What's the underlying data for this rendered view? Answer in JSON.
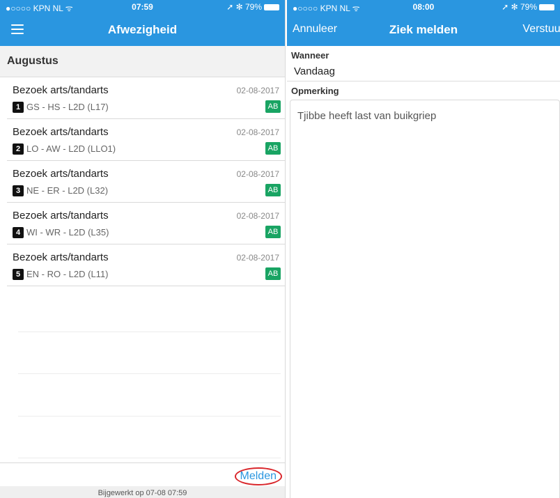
{
  "left": {
    "status": {
      "carrier": "●○○○○ KPN NL ᯤ",
      "time": "07:59",
      "battery": "➚ ✻ 79%"
    },
    "nav": {
      "title": "Afwezigheid"
    },
    "section": "Augustus",
    "items": [
      {
        "title": "Bezoek arts/tandarts",
        "date": "02-08-2017",
        "num": "1",
        "sub": "GS - HS - L2D (L17)",
        "badge": "AB"
      },
      {
        "title": "Bezoek arts/tandarts",
        "date": "02-08-2017",
        "num": "2",
        "sub": "LO - AW - L2D (LLO1)",
        "badge": "AB"
      },
      {
        "title": "Bezoek arts/tandarts",
        "date": "02-08-2017",
        "num": "3",
        "sub": "NE - ER - L2D (L32)",
        "badge": "AB"
      },
      {
        "title": "Bezoek arts/tandarts",
        "date": "02-08-2017",
        "num": "4",
        "sub": "WI - WR - L2D (L35)",
        "badge": "AB"
      },
      {
        "title": "Bezoek arts/tandarts",
        "date": "02-08-2017",
        "num": "5",
        "sub": "EN - RO - L2D (L11)",
        "badge": "AB"
      }
    ],
    "melden": "Melden",
    "updated": "Bijgewerkt op 07-08 07:59"
  },
  "right": {
    "status": {
      "carrier": "●○○○○ KPN NL ᯤ",
      "time": "08:00",
      "battery": "➚ ✻ 79%"
    },
    "nav": {
      "cancel": "Annuleer",
      "title": "Ziek melden",
      "send": "Verstuur"
    },
    "when_label": "Wanneer",
    "when_value": "Vandaag",
    "remark_label": "Opmerking",
    "remark_value": "Tjibbe heeft last van buikgriep"
  },
  "colors": {
    "brand": "#2a96e0",
    "badge_green": "#19a463",
    "highlight_red": "#d9262b"
  }
}
